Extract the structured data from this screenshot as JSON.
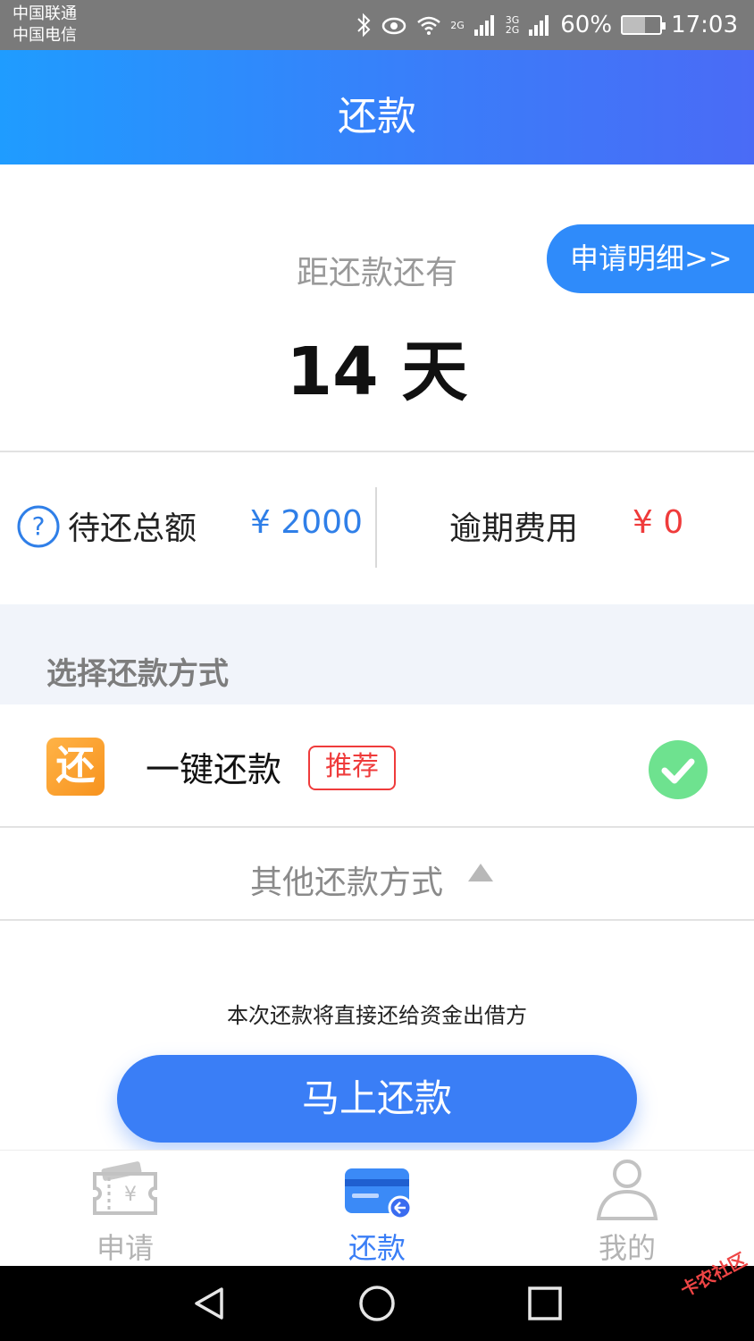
{
  "status_bar": {
    "carrier_1": "中国联通",
    "carrier_2": "中国电信",
    "net_1": "2G",
    "net_2a": "3G",
    "net_2b": "2G",
    "battery": "60%",
    "time": "17:03"
  },
  "header": {
    "title": "还款"
  },
  "countdown": {
    "detail_button": "申请明细>>",
    "label": "距还款还有",
    "value": "14 天"
  },
  "amounts": {
    "total_label": "待还总额",
    "total_value": "¥ 2000",
    "late_label": "逾期费用",
    "late_value": "¥ 0"
  },
  "method": {
    "section_title": "选择还款方式",
    "icon_char": "还",
    "name": "一键还款",
    "badge": "推荐",
    "other": "其他还款方式"
  },
  "note": "本次还款将直接还给资金出借方",
  "pay_button": "马上还款",
  "tabs": [
    {
      "label": "申请",
      "active": false
    },
    {
      "label": "还款",
      "active": true
    },
    {
      "label": "我的",
      "active": false
    }
  ],
  "colors": {
    "primary": "#3a7ef6",
    "accent_red": "#ef3b3b",
    "success": "#6ee28f",
    "tab_inactive": "#b3b3b3"
  },
  "watermark": "卡农社区"
}
